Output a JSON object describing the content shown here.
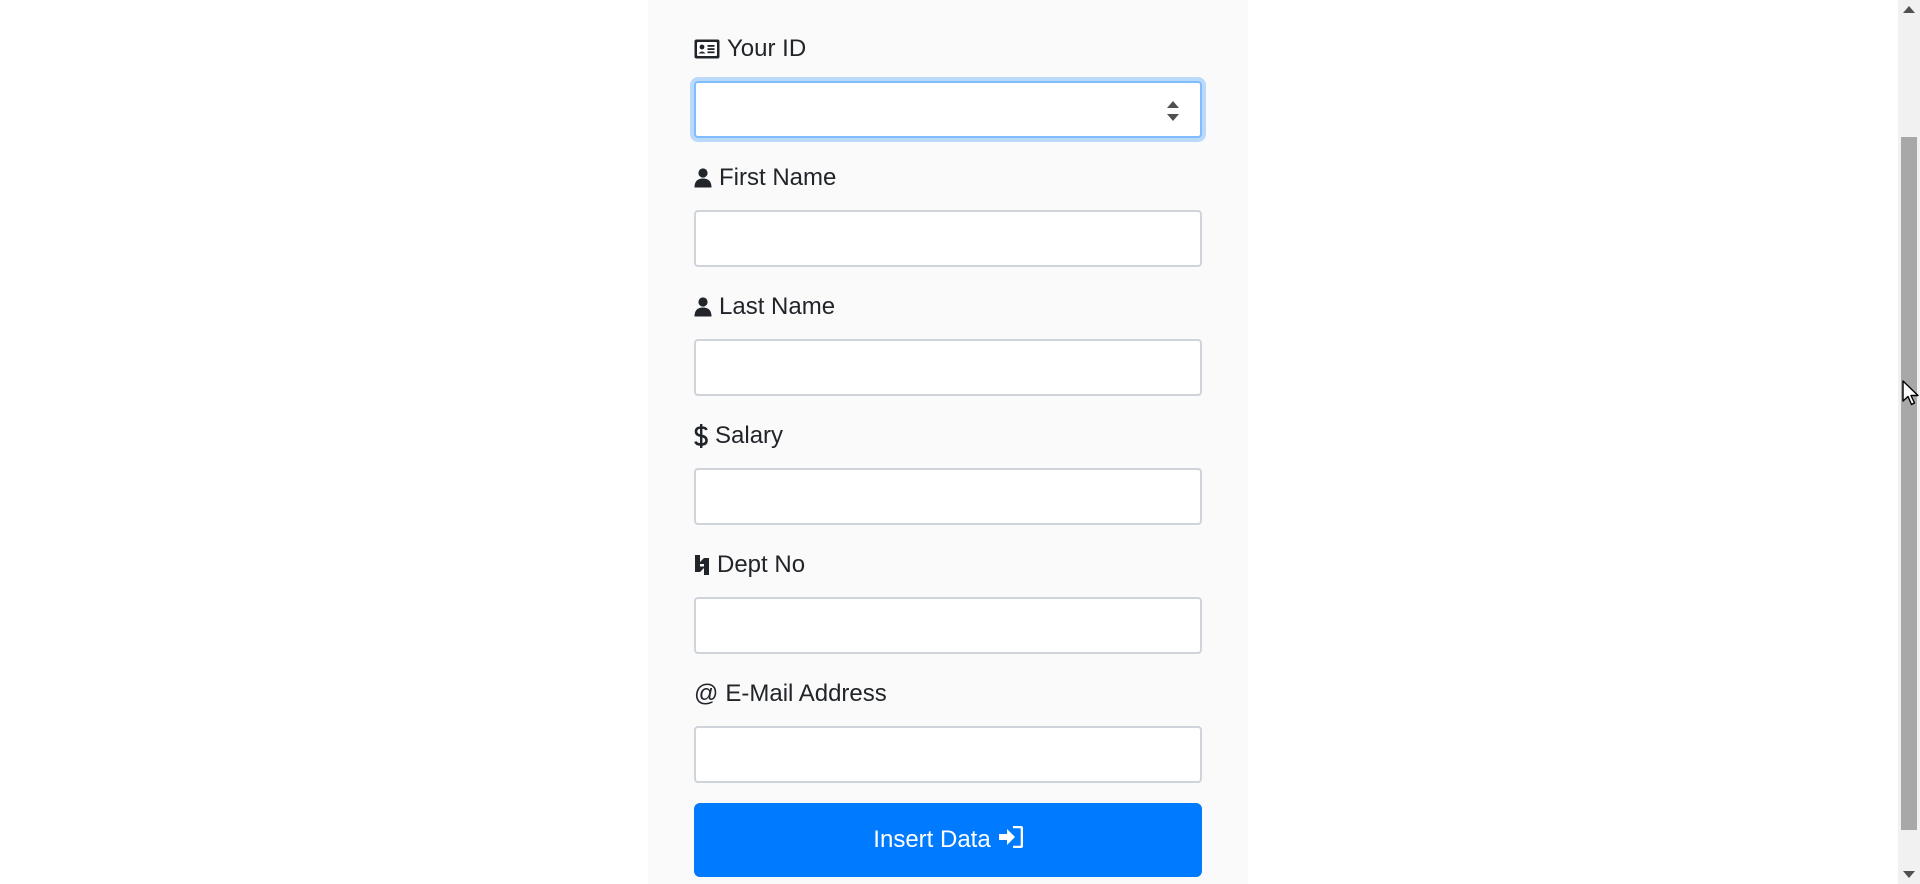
{
  "form": {
    "fields": [
      {
        "label": "Your ID",
        "icon": "id-card-icon",
        "value": "",
        "type": "number",
        "focused": true
      },
      {
        "label": "First Name",
        "icon": "user-icon",
        "value": ""
      },
      {
        "label": "Last Name",
        "icon": "user-icon",
        "value": ""
      },
      {
        "label": "Salary",
        "icon": "dollar-icon",
        "value": ""
      },
      {
        "label": "Dept No",
        "icon": "department-icon",
        "value": ""
      },
      {
        "label": "E-Mail Address",
        "icon": "at-icon",
        "value": ""
      }
    ],
    "submit_label": "Insert Data",
    "submit_icon": "sign-in-icon"
  },
  "colors": {
    "primary": "#007bff",
    "focus_border": "#80bdff",
    "input_border": "#ced4da",
    "card_bg": "#fafafa"
  }
}
